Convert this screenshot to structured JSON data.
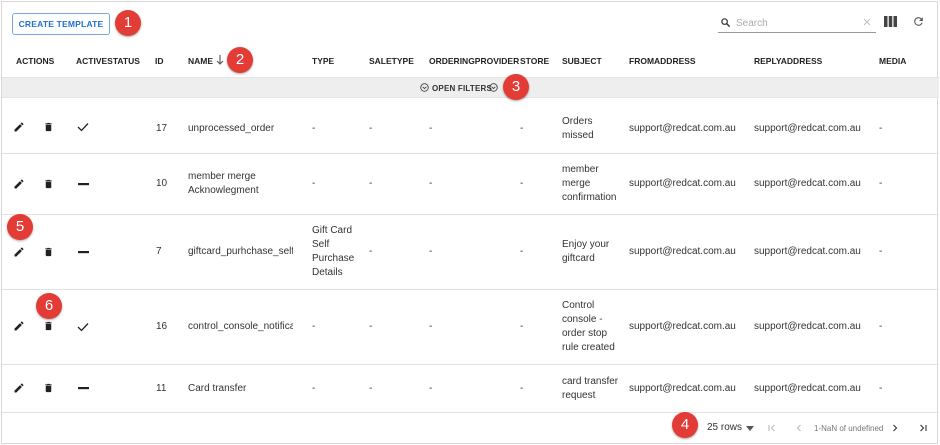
{
  "toolbar": {
    "create_label": "CREATE TEMPLATE"
  },
  "search": {
    "placeholder": "Search"
  },
  "columns": [
    "ACTIONS",
    "ACTIVESTATUS",
    "ID",
    "NAME",
    "TYPE",
    "SALETYPE",
    "ORDERINGPROVIDER",
    "STORE",
    "SUBJECT",
    "FROMADDRESS",
    "REPLYADDRESS",
    "MEDIA"
  ],
  "filters": {
    "label": "OPEN FILTERS"
  },
  "rows": [
    {
      "id": "17",
      "name": "unprocessed_order",
      "type": "-",
      "saletype": "-",
      "orderingprovider": "-",
      "store": "-",
      "subject": "Orders missed",
      "from": "support@redcat.com.au",
      "reply": "support@redcat.com.au",
      "media": "-",
      "status": "check"
    },
    {
      "id": "10",
      "name": "member merge Acknowlegment",
      "type": "-",
      "saletype": "-",
      "orderingprovider": "-",
      "store": "-",
      "subject": "member merge confirmation",
      "from": "support@redcat.com.au",
      "reply": "support@redcat.com.au",
      "media": "-",
      "status": "dash"
    },
    {
      "id": "7",
      "name": "giftcard_purhchase_self",
      "type": "Gift Card Self Purchase Details",
      "saletype": "-",
      "orderingprovider": "-",
      "store": "-",
      "subject": "Enjoy your giftcard",
      "from": "support@redcat.com.au",
      "reply": "support@redcat.com.au",
      "media": "-",
      "status": "dash"
    },
    {
      "id": "16",
      "name": "control_console_notification",
      "type": "-",
      "saletype": "-",
      "orderingprovider": "-",
      "store": "-",
      "subject": "Control console - order stop rule created",
      "from": "support@redcat.com.au",
      "reply": "support@redcat.com.au",
      "media": "-",
      "status": "check"
    },
    {
      "id": "11",
      "name": "Card transfer",
      "type": "-",
      "saletype": "-",
      "orderingprovider": "-",
      "store": "-",
      "subject": "card transfer request",
      "from": "support@redcat.com.au",
      "reply": "support@redcat.com.au",
      "media": "-",
      "status": "dash"
    }
  ],
  "pagination": {
    "rows_label": "25 rows",
    "range_text": "1-NaN of undefined"
  },
  "annotations": [
    "1",
    "2",
    "3",
    "4",
    "5",
    "6"
  ],
  "colors": {
    "accent": "#1f6fd1",
    "badge": "#e33b35",
    "filterbar": "#eeeeee"
  },
  "icons": {
    "search": "search-icon",
    "clear": "clear-icon",
    "columns": "columns-icon",
    "refresh": "refresh-icon",
    "edit": "edit-pencil-icon",
    "delete": "delete-trash-icon",
    "active": "check-icon",
    "inactive": "dash-icon",
    "sort": "sort-down-arrow-icon",
    "filter_toggle": "chevron-circle-down-icon",
    "rows_dropdown": "caret-down-icon",
    "first_page": "first-page-icon",
    "prev_page": "prev-page-icon",
    "next_page": "next-page-icon",
    "last_page": "last-page-icon"
  }
}
